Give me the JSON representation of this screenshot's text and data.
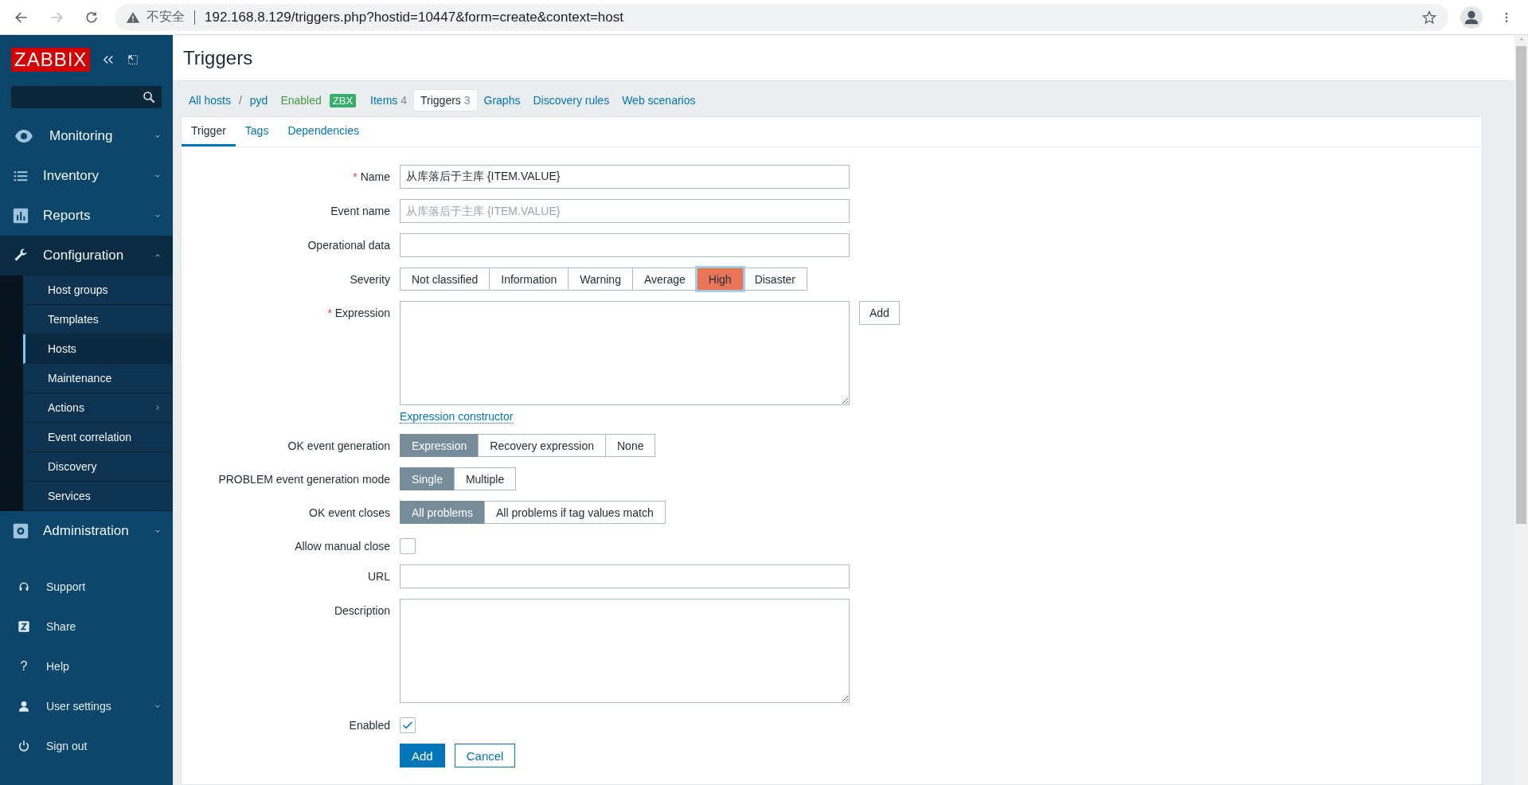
{
  "browser": {
    "insecure_label": "不安全",
    "url": "192.168.8.129/triggers.php?hostid=10447&form=create&context=host"
  },
  "sidebar": {
    "logo": "ZABBIX",
    "menu": [
      {
        "label": "Monitoring",
        "expanded": false
      },
      {
        "label": "Inventory",
        "expanded": false
      },
      {
        "label": "Reports",
        "expanded": false
      },
      {
        "label": "Configuration",
        "expanded": true,
        "children": [
          {
            "label": "Host groups",
            "selected": false,
            "submenu": false
          },
          {
            "label": "Templates",
            "selected": false,
            "submenu": false
          },
          {
            "label": "Hosts",
            "selected": true,
            "submenu": false
          },
          {
            "label": "Maintenance",
            "selected": false,
            "submenu": false
          },
          {
            "label": "Actions",
            "selected": false,
            "submenu": true
          },
          {
            "label": "Event correlation",
            "selected": false,
            "submenu": false
          },
          {
            "label": "Discovery",
            "selected": false,
            "submenu": false
          },
          {
            "label": "Services",
            "selected": false,
            "submenu": false
          }
        ]
      },
      {
        "label": "Administration",
        "expanded": false
      }
    ],
    "user_menu": [
      {
        "label": "Support",
        "dropdown": false
      },
      {
        "label": "Share",
        "dropdown": false
      },
      {
        "label": "Help",
        "glyph": "?",
        "dropdown": false
      },
      {
        "label": "User settings",
        "dropdown": true
      },
      {
        "label": "Sign out",
        "dropdown": false
      }
    ]
  },
  "page": {
    "title": "Triggers"
  },
  "host_nav": {
    "breadcrumbs": [
      "All hosts",
      "pyd"
    ],
    "separator": "/",
    "status": "Enabled",
    "badge": "ZBX",
    "links": [
      {
        "label": "Items",
        "count": "4",
        "selected": false
      },
      {
        "label": "Triggers",
        "count": "3",
        "selected": true
      },
      {
        "label": "Graphs",
        "selected": false
      },
      {
        "label": "Discovery rules",
        "selected": false
      },
      {
        "label": "Web scenarios",
        "selected": false
      }
    ]
  },
  "tabs": [
    {
      "label": "Trigger",
      "selected": true
    },
    {
      "label": "Tags",
      "selected": false
    },
    {
      "label": "Dependencies",
      "selected": false
    }
  ],
  "form": [
    {
      "kind": "text",
      "label": "Name",
      "mark": "*",
      "value": "从库落后于主库 {ITEM.VALUE}"
    },
    {
      "kind": "text",
      "label": "Event name",
      "placeholder": "从库落后于主库 {ITEM.VALUE}"
    },
    {
      "kind": "text",
      "label": "Operational data"
    },
    {
      "kind": "severity",
      "label": "Severity",
      "options": [
        {
          "label": "Not classified",
          "selected": false
        },
        {
          "label": "Information",
          "selected": false
        },
        {
          "label": "Warning",
          "selected": false
        },
        {
          "label": "Average",
          "selected": false
        },
        {
          "label": "High",
          "selected": true
        },
        {
          "label": "Disaster",
          "selected": false
        }
      ]
    },
    {
      "kind": "textarea",
      "label": "Expression",
      "mark": "*",
      "button": "Add",
      "link": "Expression constructor"
    },
    {
      "kind": "radio",
      "label": "OK event generation",
      "options": [
        {
          "label": "Expression",
          "selected": true
        },
        {
          "label": "Recovery expression",
          "selected": false
        },
        {
          "label": "None",
          "selected": false
        }
      ]
    },
    {
      "kind": "radio",
      "label": "PROBLEM event generation mode",
      "options": [
        {
          "label": "Single",
          "selected": true
        },
        {
          "label": "Multiple",
          "selected": false
        }
      ]
    },
    {
      "kind": "radio",
      "label": "OK event closes",
      "options": [
        {
          "label": "All problems",
          "selected": true
        },
        {
          "label": "All problems if tag values match",
          "selected": false
        }
      ]
    },
    {
      "kind": "checkbox",
      "label": "Allow manual close",
      "checked": false
    },
    {
      "kind": "text",
      "label": "URL"
    },
    {
      "kind": "textarea",
      "label": "Description"
    },
    {
      "kind": "checkbox",
      "label": "Enabled",
      "checked": true
    }
  ],
  "actions": [
    {
      "label": "Add",
      "primary": true
    },
    {
      "label": "Cancel",
      "primary": false
    }
  ]
}
